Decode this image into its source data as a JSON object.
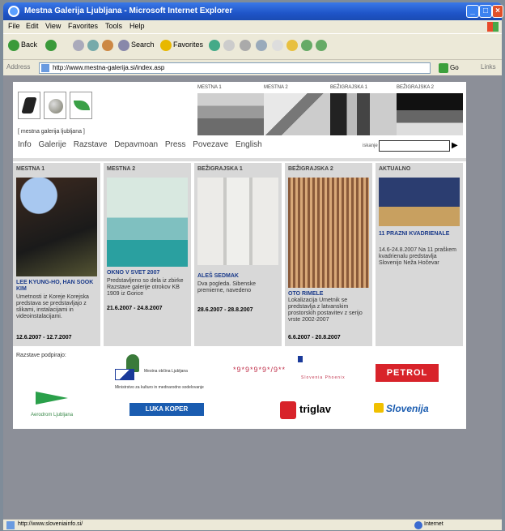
{
  "window": {
    "title": "Mestna Galerija Ljubljana - Microsoft Internet Explorer"
  },
  "menu": [
    "File",
    "Edit",
    "View",
    "Favorites",
    "Tools",
    "Help"
  ],
  "toolbar": {
    "back": "Back",
    "search": "Search",
    "favorites": "Favorites"
  },
  "address": {
    "label": "Address",
    "value": "http://www.mestna-galerija.si/index.asp",
    "go": "Go",
    "links": "Links"
  },
  "site": {
    "tagline": "[ mestna  galerija  ljubljana ]",
    "top_thumbs": [
      "MESTNA 1",
      "MESTNA 2",
      "BEŽIGRAJSKA 1",
      "BEŽIGRAJSKA 2"
    ],
    "nav": [
      "Info",
      "Galerije",
      "Razstave",
      "Depavmoan",
      "Press",
      "Povezave",
      "English"
    ],
    "search_label": "iskanje",
    "search_go": "▶",
    "cards": [
      {
        "head": "MESTNA 1",
        "title": "LEE KYUNG-HO, HAN SOOK KIM",
        "desc": "Umetnosti iz Koreje Korejska predstava se predstavljajo z slikami, instalacijami in videoinstalacijami.",
        "date": "12.6.2007 - 12.7.2007"
      },
      {
        "head": "MESTNA 2",
        "title": "OKNO V SVET 2007",
        "desc": "Predstavljeno so dela iz zbirke Razstave galerije otrokov KB 1909 iz Gorice",
        "date": "21.6.2007 - 24.8.2007"
      },
      {
        "head": "BEŽIGRAJSKA 1",
        "title": "ALEŠ SEDMAK",
        "desc": "Dva pogleda. Sibenske premierne, navedeno",
        "date": "28.6.2007 - 28.8.2007"
      },
      {
        "head": "BEŽIGRAJSKA 2",
        "title": "OTO RIMELE",
        "desc": "Lokalizacija Umetnik se predstavlja z latvanskim prostorskih postavitev z serijo vrste 2002-2007",
        "date": "6.6.2007 - 20.8.2007"
      },
      {
        "head": "AKTUALNO",
        "title": "11 PRAZNI KVADRIENALE",
        "desc": "14.6-24.8.2007 Na 11 praškem kvadrienalu predstavlja Slovenijo Neža Hočevar",
        "date": ""
      }
    ],
    "sponsors_title": "Razstave podpirajo:",
    "sponsors": {
      "plane_label": "Aerodrom Ljubljana",
      "moc": "Mestna občina Ljubljana",
      "moc_sub": "Ministrstvo za kulturo in mednarodno sodelovanje",
      "stars": "*9*9*9*9*/9**",
      "stars_sub": "Slovenia Phoenix",
      "petrol": "PETROL",
      "luka": "LUKA KOPER",
      "triglav": "triglav",
      "slovenija": "Slovenija"
    }
  },
  "status": {
    "url": "http://www.sloveniainfo.si/",
    "zone": "Internet"
  }
}
